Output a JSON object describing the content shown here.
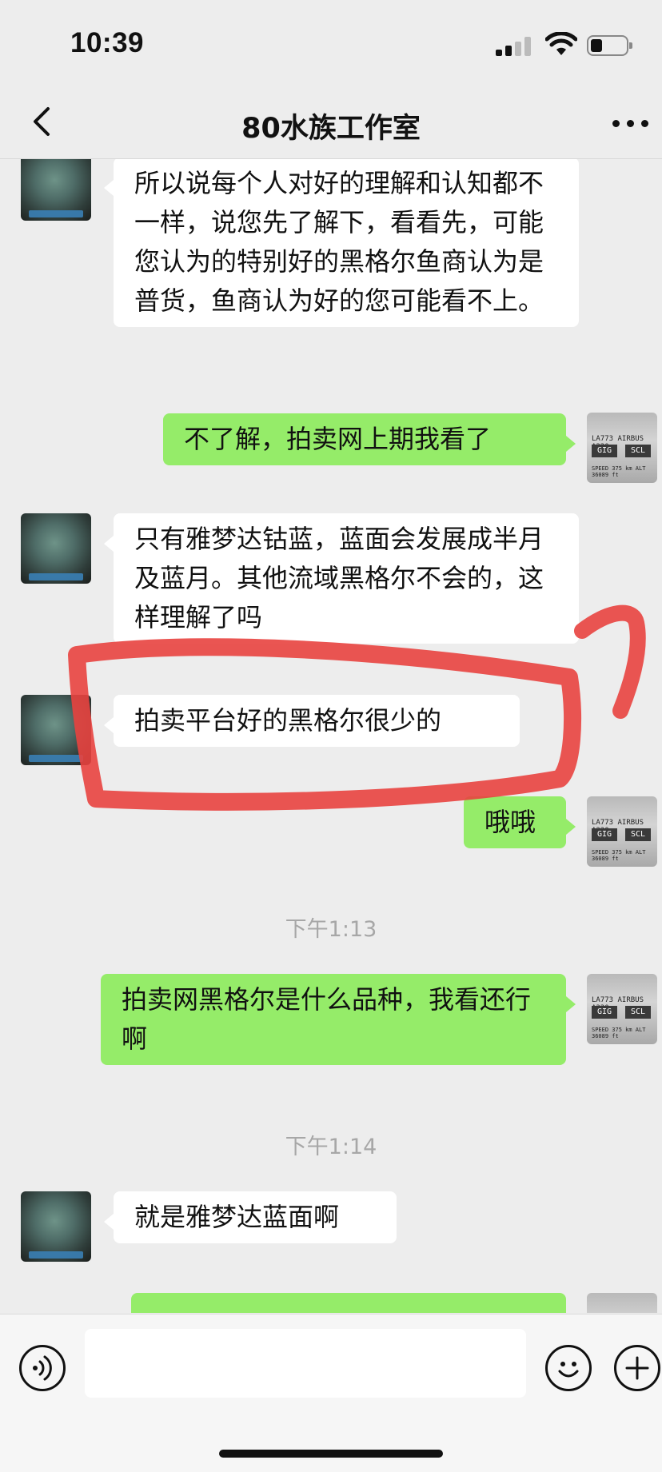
{
  "status": {
    "time": "10:39"
  },
  "header": {
    "title": "80水族工作室",
    "back_icon": "chevron-left-icon",
    "more_icon": "ellipsis-icon"
  },
  "messages": [
    {
      "side": "in",
      "text": "所以说每个人对好的理解和认知都不一样，说您先了解下，看看先，可能您认为的特别好的黑格尔鱼商认为是普货，鱼商认为好的您可能看不上。"
    },
    {
      "side": "out",
      "text": "不了解，拍卖网上期我看了"
    },
    {
      "side": "in",
      "text": "只有雅梦达钴蓝，蓝面会发展成半月及蓝月。其他流域黑格尔不会的，这样理解了吗"
    },
    {
      "side": "in",
      "text": "拍卖平台好的黑格尔很少的"
    },
    {
      "side": "out",
      "text": "哦哦"
    },
    {
      "side": "out",
      "text": "拍卖网黑格尔是什么品种，我看还行啊"
    },
    {
      "side": "in",
      "text": "就是雅梦达蓝面啊"
    },
    {
      "side": "out",
      "text": ""
    }
  ],
  "timestamps": [
    "下午1:13",
    "下午1:14"
  ],
  "avatar_board": {
    "flight": "LA773",
    "aircraft": "AIRBUS A320",
    "from": "GIG",
    "to": "SCL",
    "speed_line": "SPEED 375 km ALT 36089 ft"
  },
  "input": {
    "value": "",
    "voice_icon": "voice-icon",
    "emoji_icon": "emoji-icon",
    "plus_icon": "plus-icon"
  },
  "colors": {
    "background": "#ededed",
    "out_bubble": "#95ec69",
    "in_bubble": "#ffffff",
    "annotation": "#e8433f"
  }
}
